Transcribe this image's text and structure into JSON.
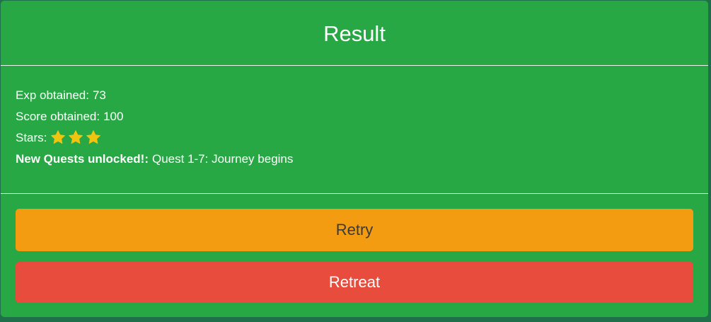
{
  "modal": {
    "title": "Result",
    "exp_label": "Exp obtained:",
    "exp_value": "73",
    "score_label": "Score obtained:",
    "score_value": "100",
    "stars_label": "Stars:",
    "stars_count": 3,
    "quests_label": "New Quests unlocked!:",
    "quests_value": "Quest 1-7: Journey begins",
    "retry_label": "Retry",
    "retreat_label": "Retreat"
  },
  "colors": {
    "modal_bg": "#28a745",
    "retry_bg": "#f39c12",
    "retreat_bg": "#e74c3c",
    "star": "#f1c40f"
  }
}
